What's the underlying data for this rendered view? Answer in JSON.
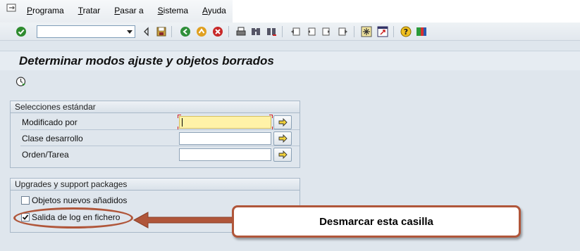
{
  "menu": {
    "items": [
      {
        "underline": "P",
        "rest": "rograma"
      },
      {
        "underline": "T",
        "rest": "ratar"
      },
      {
        "underline": "P",
        "rest": "asar a"
      },
      {
        "underline": "S",
        "rest": "istema"
      },
      {
        "underline": "A",
        "rest": "yuda"
      }
    ]
  },
  "toolbar": {
    "command_value": "",
    "icons": [
      "enter-icon",
      "back-icon",
      "save-icon",
      "back-nav-icon",
      "exit-icon",
      "cancel-icon",
      "print-icon",
      "find-icon",
      "find-next-icon",
      "first-page-icon",
      "prev-page-icon",
      "next-page-icon",
      "last-page-icon",
      "create-session-icon",
      "shortcut-icon",
      "help-icon",
      "layout-icon"
    ]
  },
  "page": {
    "title": "Determinar modos ajuste y objetos borrados"
  },
  "selection_group": {
    "header": "Selecciones estándar",
    "fields": [
      {
        "label": "Modificado por",
        "value": ""
      },
      {
        "label": "Clase desarrollo",
        "value": ""
      },
      {
        "label": "Orden/Tarea",
        "value": ""
      }
    ]
  },
  "upgrade_group": {
    "header": "Upgrades y support packages",
    "options": [
      {
        "label": "Objetos nuevos añadidos",
        "checked": false
      },
      {
        "label": "Salida de log en fichero",
        "checked": true
      }
    ]
  },
  "annotation": {
    "text": "Desmarcar esta casilla",
    "color": "#b0563a"
  },
  "colors": {
    "background": "#dfe6ed",
    "active_field": "#fff2a8"
  }
}
